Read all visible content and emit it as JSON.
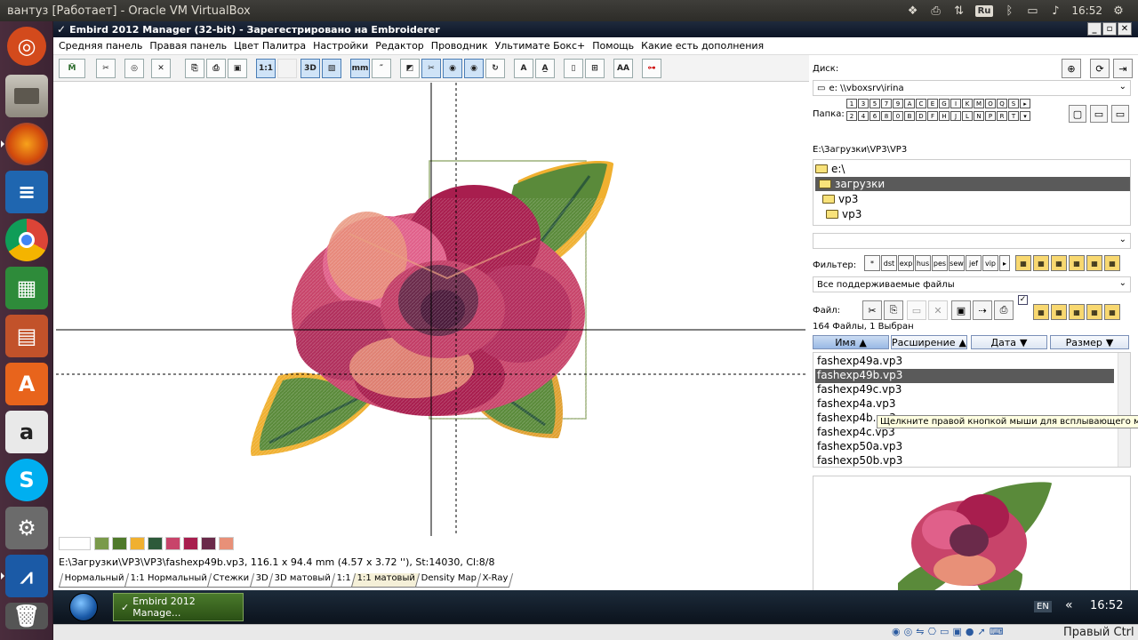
{
  "ubuntu": {
    "window_title": "вантуз [Работает] - Oracle VM VirtualBox",
    "keyboard": "Ru",
    "clock": "16:52"
  },
  "launcher": {
    "apps": [
      "ubuntu-dash",
      "files",
      "firefox",
      "writer",
      "chromium",
      "calc",
      "impress",
      "software-center",
      "amazon",
      "skype",
      "system-settings",
      "virtualbox",
      "trash"
    ]
  },
  "app": {
    "title": "Embird 2012 Manager (32-bit) - Зарегестрировано на Embroiderer",
    "menu": [
      "Средняя панель",
      "Правая панель",
      "Цвет Палитра",
      "Настройки",
      "Редактор",
      "Проводник",
      "Ультимате Бокс+",
      "Помощь",
      "Какие есть дополнения"
    ],
    "toolbar": [
      "1:1",
      "3D"
    ],
    "palette_colors": [
      "#ffffff",
      "#7a9a4a",
      "#4f7a2a",
      "#f0b030",
      "#2d5a3a",
      "#c8446a",
      "#a81e4e",
      "#6a2a4a",
      "#e89078"
    ],
    "status": "E:\\Загрузки\\VP3\\VP3\\fashexp49b.vp3, 116.1 x 94.4 mm (4.57 x 3.72 ''), St:14030, Cl:8/8",
    "view_tabs": [
      "Нормальный",
      "1:1 Нормальный",
      "Стежки",
      "3D",
      "3D матовый",
      "1:1",
      "1:1 матовый",
      "Density Map",
      "X-Ray"
    ],
    "right": {
      "disk_label": "Диск:",
      "disk_value": "e: \\\\vboxsrv\\irina",
      "folder_label": "Папка:",
      "path": "E:\\Загрузки\\VP3\\VP3",
      "tree": [
        "e:\\",
        "загрузки",
        "vp3",
        "vp3"
      ],
      "filter_label": "Фильтер:",
      "filter_types": [
        "*",
        "dst",
        "exp",
        "hus",
        "pes",
        "sew",
        "jef",
        "vip"
      ],
      "filter_select": "Все поддерживаемые файлы",
      "file_label": "Файл:",
      "count": "164 Файлы, 1 Выбран",
      "columns": [
        "Имя",
        "Расширение",
        "Дата",
        "Размер"
      ],
      "files": [
        "fashexp49a.vp3",
        "fashexp49b.vp3",
        "fashexp49c.vp3",
        "fashexp4a.vp3",
        "fashexp4b.vp3",
        "fashexp4c.vp3",
        "fashexp50a.vp3",
        "fashexp50b.vp3"
      ],
      "tooltip": "Щелкните правой кнопкой мыши для всплывающего меню",
      "keys_row1": [
        "1",
        "3",
        "5",
        "7",
        "9",
        "A",
        "C",
        "E",
        "G",
        "I",
        "K",
        "M",
        "O",
        "Q",
        "S"
      ],
      "keys_row2": [
        "2",
        "4",
        "6",
        "8",
        "0",
        "B",
        "D",
        "F",
        "H",
        "J",
        "L",
        "N",
        "P",
        "R",
        "T"
      ]
    },
    "taskbar": {
      "item": "Embird 2012 Manage...",
      "lang": "EN",
      "clock": "16:52"
    }
  },
  "vbox_status": {
    "hostkey": "Правый Ctrl"
  }
}
